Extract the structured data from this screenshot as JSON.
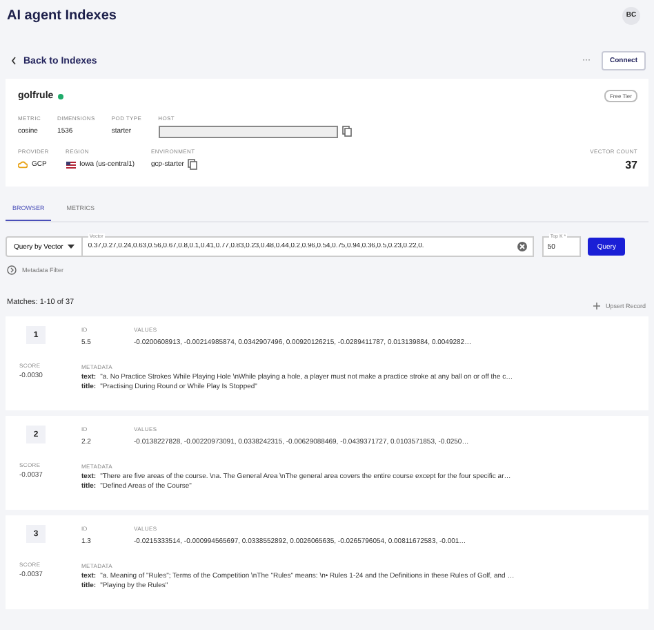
{
  "header": {
    "title": "AI agent Indexes",
    "avatar": "BC"
  },
  "nav": {
    "back": "Back to Indexes",
    "more": "···",
    "connect": "Connect"
  },
  "index": {
    "name": "golfrule",
    "ready": true,
    "tier": "Free Tier",
    "fields": [
      {
        "label": "METRIC",
        "value": "cosine",
        "kind": "text"
      },
      {
        "label": "DIMENSIONS",
        "value": "1536",
        "kind": "text"
      },
      {
        "label": "POD TYPE",
        "value": "starter",
        "kind": "text"
      },
      {
        "label": "HOST",
        "kind": "hidden"
      }
    ],
    "fields2": [
      {
        "label": "PROVIDER",
        "value": "GCP",
        "kind": "provider"
      },
      {
        "label": "REGION",
        "value": "Iowa (us-central1)",
        "kind": "region"
      },
      {
        "label": "ENVIRONMENT",
        "value": "gcp-starter",
        "kind": "copy"
      }
    ],
    "count_label": "VECTOR COUNT",
    "count": "37"
  },
  "tabs": [
    {
      "label": "BROWSER",
      "selected": true
    },
    {
      "label": "METRICS",
      "selected": false
    }
  ],
  "query": {
    "mode": "Query by Vector",
    "vector_label": "Vector",
    "vector": "0.37,0.27,0.24,0.63,0.56,0.67,0.8,0.1,0.41,0.77,0.83,0.23,0.48,0.44,0.2,0.96,0.54,0.75,0.94,0.36,0.5,0.23,0.22,0.",
    "topk_label": "Top K *",
    "topk": "50",
    "button": "Query"
  },
  "filter": "Metadata Filter",
  "matches": "Matches: 1-10 of 37",
  "upsert": "Upsert Record",
  "records": [
    {
      "rank": "1",
      "score_label": "SCORE",
      "score": "-0.0030",
      "id_label": "ID",
      "id": "5.5",
      "values_label": "VALUES",
      "values": "-0.0200608913, -0.00214985874, 0.0342907496, 0.00920126215, -0.0289411787, 0.013139884, 0.0049282…",
      "meta_label": "METADATA",
      "text_key": "text:",
      "text": "\"a. No Practice Strokes While Playing Hole \\nWhile playing a hole, a player must not make a practice stroke at any ball on or off the c…",
      "title_key": "title:",
      "title": "\"Practising During Round or While Play Is Stopped\""
    },
    {
      "rank": "2",
      "score_label": "SCORE",
      "score": "-0.0037",
      "id_label": "ID",
      "id": "2.2",
      "values_label": "VALUES",
      "values": "-0.0138227828, -0.00220973091, 0.0338242315, -0.00629088469, -0.0439371727, 0.0103571853, -0.0250…",
      "meta_label": "METADATA",
      "text_key": "text:",
      "text": "\"There are five areas of the course. \\na. The General Area \\nThe general area covers the entire course except for the four specific ar…",
      "title_key": "title:",
      "title": "\"Defined Areas of the Course\""
    },
    {
      "rank": "3",
      "score_label": "SCORE",
      "score": "-0.0037",
      "id_label": "ID",
      "id": "1.3",
      "values_label": "VALUES",
      "values": "-0.0215333514, -0.000994565697, 0.0338552892, 0.0026065635, -0.0265796054, 0.00811672583, -0.001…",
      "meta_label": "METADATA",
      "text_key": "text:",
      "text": "\"a. Meaning of \"Rules\"; Terms of the Competition \\nThe \"Rules\" means: \\n• Rules 1-24 and the Definitions in these Rules of Golf, and …",
      "title_key": "title:",
      "title": "\"Playing by the Rules\""
    }
  ]
}
